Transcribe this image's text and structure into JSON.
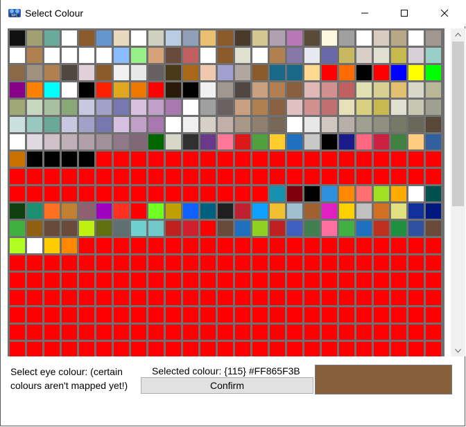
{
  "window": {
    "title": "Select Colour",
    "app_icon": "npc-app-icon",
    "controls": [
      "minimize-icon",
      "maximize-icon",
      "close-icon"
    ]
  },
  "palette": {
    "columns": 25,
    "colors": [
      "#111111",
      "#a0a070",
      "#6aaa9a",
      "#ffffff",
      "#8b5a2b",
      "#6495cd",
      "#e8d8c0",
      "#ffffff",
      "#d0d0c0",
      "#b8cce4",
      "#90a0b8",
      "#e8c070",
      "#8b5a2b",
      "#4a3a2a",
      "#d4c890",
      "#b0a0b0",
      "#b878b8",
      "#5a4a3a",
      "#fff8e0",
      "#a0a0a0",
      "#ffffff",
      "#d8ccc0",
      "#b8a888",
      "#ffffff",
      "#a09890",
      "#ffffff",
      "#b08050",
      "#ffffff",
      "#ffffff",
      "#ffffff",
      "#ffffff",
      "#88bbff",
      "#98ee88",
      "#d4a478",
      "#6a4a3a",
      "#c06060",
      "#ffffff",
      "#8b5a2b",
      "#e0e0d0",
      "#ffffff",
      "#b08050",
      "#8878a8",
      "#e8e8f0",
      "#6868a8",
      "#c8b860",
      "#d8d0c8",
      "#e0e0d0",
      "#c8b850",
      "#d8d0d8",
      "#98d0c8",
      "#8b6848",
      "#a09080",
      "#b08050",
      "#504840",
      "#e0d0d8",
      "#8b5a2b",
      "#f0f0f0",
      "#e8e8e8",
      "#686060",
      "#4a3a1a",
      "#a86818",
      "#f0c8b0",
      "#a0a0d0",
      "#b0a8a0",
      "#8b5a2b",
      "#186888",
      "#186888",
      "#ffd890",
      "#ff0000",
      "#ff6a00",
      "#000000",
      "#ff0000",
      "#0000ff",
      "#ffff00",
      "#00ff00",
      "#880088",
      "#ff7f00",
      "#00ffff",
      "#ffffff",
      "#000000",
      "#ff2000",
      "#e0a820",
      "#ee7700",
      "#ff0000",
      "#2a1a0a",
      "#000000",
      "#f0f0f0",
      "#a09890",
      "#504840",
      "#c8a080",
      "#b08050",
      "#886040",
      "#e0b8b8",
      "#d09090",
      "#c06060",
      "#e0e0b0",
      "#d8d090",
      "#e0c070",
      "#d8d8c8",
      "#b8b898",
      "#a0a878",
      "#c8d8c0",
      "#a8c0a0",
      "#88a878",
      "#c8c8e0",
      "#a0a0c8",
      "#7878b0",
      "#d8c0e0",
      "#c0a0c8",
      "#a878b0",
      "#ffffff",
      "#a0a0a0",
      "#6a6060",
      "#c8a080",
      "#b08050",
      "#8b6040",
      "#e0c0c0",
      "#d09090",
      "#c07070",
      "#e8e0b8",
      "#d8d080",
      "#c8b850",
      "#e0e0d0",
      "#c8c8b0",
      "#a0a090",
      "#c8e0e0",
      "#98c8c0",
      "#6aa898",
      "#c8c8e0",
      "#a0a0c8",
      "#7878b0",
      "#d8c0e0",
      "#c0a0c8",
      "#a878b0",
      "#ffffff",
      "#f0f0f0",
      "#d8d0c8",
      "#c0b0a8",
      "#a89888",
      "#908070",
      "#786858",
      "#ffffff",
      "#e8e8e8",
      "#d0c8c0",
      "#b8b0a8",
      "#a0a090",
      "#909080",
      "#787868",
      "#686858",
      "#584838",
      "#ffffff",
      "#e0d8e0",
      "#d0c0c8",
      "#c0b0b8",
      "#b0a0a8",
      "#a09098",
      "#907888",
      "#806878",
      "#006600",
      "#d8d8c8",
      "#303030",
      "#6a3a8a",
      "#ff7898",
      "#dd1818",
      "#50a040",
      "#ffcc30",
      "#2070c0",
      "#c8c8c8",
      "#000000",
      "#1a1a8a",
      "#ff6880",
      "#cc2040",
      "#408040",
      "#ffcc80",
      "#3060a0",
      "#c87000",
      "#000000",
      "#000000",
      "#000000",
      "#000000",
      "#ff0000",
      "#ff0000",
      "#ff0000",
      "#ff0000",
      "#ff0000",
      "#ff0000",
      "#ff0000",
      "#ff0000",
      "#ff0000",
      "#ff0000",
      "#ff0000",
      "#ff0000",
      "#ff0000",
      "#ff0000",
      "#ff0000",
      "#ff0000",
      "#ff0000",
      "#ff0000",
      "#ff0000",
      "#ff0000",
      "#ff0000",
      "#ff0000",
      "#ff0000",
      "#ff0000",
      "#ff0000",
      "#ff0000",
      "#ff0000",
      "#ff0000",
      "#ff0000",
      "#ff0000",
      "#ff0000",
      "#ff0000",
      "#ff0000",
      "#ff0000",
      "#ff0000",
      "#ff0000",
      "#ff0000",
      "#ff0000",
      "#ff0000",
      "#ff0000",
      "#ff0000",
      "#ff0000",
      "#ff0000",
      "#ff0000",
      "#ff0000",
      "#ff0000",
      "#ff0000",
      "#ff0000",
      "#ff0000",
      "#ff0000",
      "#ff0000",
      "#ff0000",
      "#ff0000",
      "#ff0000",
      "#ff0000",
      "#ff0000",
      "#ff0000",
      "#ff0000",
      "#ff0000",
      "#ff0000",
      "#1890b0",
      "#800010",
      "#000000",
      "#3090e0",
      "#ff8800",
      "#ff7070",
      "#a0e020",
      "#ffaa00",
      "#ffffff",
      "#005050",
      "#104010",
      "#1a9070",
      "#ff7020",
      "#c08030",
      "#906070",
      "#a000c0",
      "#ff3020",
      "#ff0000",
      "#70ff20",
      "#c0a000",
      "#1060ff",
      "#006080",
      "#202020",
      "#c02030",
      "#10a0ff",
      "#f0c030",
      "#a0c0d0",
      "#a06030",
      "#e020c0",
      "#ffd000",
      "#c0c0c0",
      "#d07020",
      "#e0e080",
      "#10309a",
      "#001880",
      "#40b040",
      "#906010",
      "#6a4a3a",
      "#6a4a3a",
      "#c0f010",
      "#607010",
      "#607070",
      "#70d0d0",
      "#70c8c8",
      "#c02020",
      "#d02030",
      "#ff0000",
      "#6a4a3a",
      "#2070c0",
      "#90d020",
      "#c02020",
      "#4060c0",
      "#408050",
      "#ff70a0",
      "#40b040",
      "#2070c0",
      "#c03020",
      "#209040",
      "#3050a0",
      "#6a4a3a",
      "#b0ff20",
      "#ffffff",
      "#ffcc00",
      "#ff8800",
      "#ff0000",
      "#ff0000",
      "#ff0000",
      "#ff0000",
      "#ff0000",
      "#ff0000",
      "#ff0000",
      "#ff0000",
      "#ff0000",
      "#ff0000",
      "#ff0000",
      "#ff0000",
      "#ff0000",
      "#ff0000",
      "#ff0000",
      "#ff0000",
      "#ff0000",
      "#ff0000",
      "#ff0000",
      "#ff0000",
      "#ff0000",
      "#ff0000",
      "#ff0000",
      "#ff0000",
      "#ff0000",
      "#ff0000",
      "#ff0000",
      "#ff0000",
      "#ff0000",
      "#ff0000",
      "#ff0000",
      "#ff0000",
      "#ff0000",
      "#ff0000",
      "#ff0000",
      "#ff0000",
      "#ff0000",
      "#ff0000",
      "#ff0000",
      "#ff0000",
      "#ff0000",
      "#ff0000",
      "#ff0000",
      "#ff0000",
      "#ff0000",
      "#ff0000",
      "#ff0000",
      "#ff0000",
      "#ff0000",
      "#ff0000",
      "#ff0000",
      "#ff0000",
      "#ff0000",
      "#ff0000",
      "#ff0000",
      "#ff0000",
      "#ff0000",
      "#ff0000",
      "#ff0000",
      "#ff0000",
      "#ff0000",
      "#ff0000",
      "#ff0000",
      "#ff0000",
      "#ff0000",
      "#ff0000",
      "#ff0000",
      "#ff0000",
      "#ff0000",
      "#ff0000",
      "#ff0000",
      "#ff0000",
      "#ff0000",
      "#ff0000",
      "#ff0000",
      "#ff0000",
      "#ff0000",
      "#ff0000",
      "#ff0000",
      "#ff0000",
      "#ff0000",
      "#ff0000",
      "#ff0000",
      "#ff0000",
      "#ff0000",
      "#ff0000",
      "#ff0000",
      "#ff0000",
      "#ff0000",
      "#ff0000",
      "#ff0000",
      "#ff0000",
      "#ff0000",
      "#ff0000",
      "#ff0000",
      "#ff0000",
      "#ff0000",
      "#ff0000",
      "#ff0000",
      "#ff0000",
      "#ff0000",
      "#ff0000",
      "#ff0000",
      "#ff0000",
      "#ff0000",
      "#ff0000",
      "#ff0000",
      "#ff0000",
      "#ff0000",
      "#ff0000",
      "#ff0000",
      "#ff0000",
      "#ff0000",
      "#ff0000",
      "#ff0000",
      "#ff0000",
      "#ff0000",
      "#ff0000",
      "#ff0000",
      "#ff0000",
      "#ff0000",
      "#ff0000",
      "#ff0000",
      "#ff0000",
      "#ff0000",
      "#ff0000",
      "#ff0000",
      "#ff0000",
      "#ff0000",
      "#ff0000",
      "#ff0000",
      "#ff0000",
      "#ff0000",
      "#ff0000",
      "#ff0000",
      "#ff0000",
      "#ff0000",
      "#ff0000",
      "#ff0000",
      "#ff0000",
      "#ff0000",
      "#ff0000",
      "#ff0000",
      "#ff0000",
      "#ff0000",
      "#ff0000",
      "#ff0000",
      "#ff0000",
      "#ff0000",
      "#ff0000",
      "#ff0000",
      "#ff0000",
      "#ff0000",
      "#ff0000",
      "#ff0000",
      "#ff0000",
      "#ff0000",
      "#ff0000",
      "#ff0000",
      "#ff0000",
      "#ff0000",
      "#ff0000",
      "#ff0000",
      "#ff0000",
      "#ff0000",
      "#ff0000",
      "#ff0000",
      "#ff0000",
      "#ff0000",
      "#ff0000",
      "#ff0000"
    ]
  },
  "scrollbar": {
    "up_icon": "chevron-up-icon",
    "down_icon": "chevron-down-icon",
    "thumb_fraction": 0.5
  },
  "footer": {
    "prompt": "Select eye colour: (certain colours aren't mapped yet!)",
    "selected_label": "Selected colour: {115} #FF865F3B",
    "confirm_label": "Confirm",
    "selected_color": "#865F3B"
  }
}
